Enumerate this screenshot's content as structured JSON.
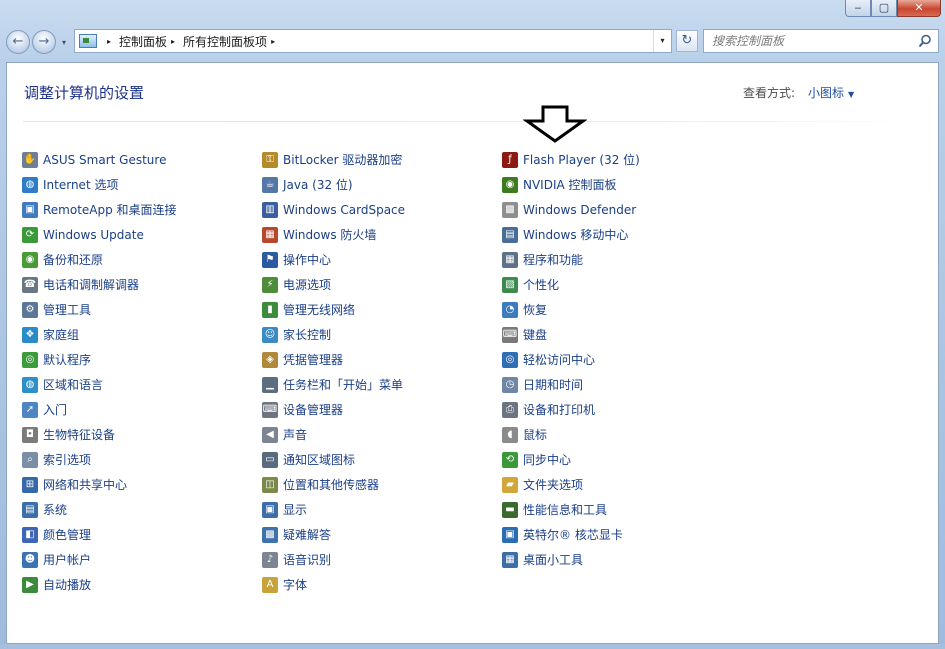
{
  "window": {
    "min_glyph": "‒",
    "max_glyph": "▢",
    "close_glyph": "✕"
  },
  "nav": {
    "back_glyph": "←",
    "forward_glyph": "→",
    "history_glyph": "▾",
    "breadcrumbs": [
      "控制面板",
      "所有控制面板项"
    ],
    "crumb_sep": "▸",
    "address_drop_glyph": "▾",
    "refresh_glyph": "↻",
    "search_placeholder": "搜索控制面板"
  },
  "header": {
    "title": "调整计算机的设置",
    "view_by_label": "查看方式:",
    "view_by_value": "小图标",
    "view_by_caret": "▼"
  },
  "colors": {
    "link": "#1a3f86",
    "title": "#1e3287"
  },
  "columns": [
    [
      {
        "label": "ASUS Smart Gesture",
        "icon": "touchpad-icon",
        "glyph": "✋",
        "color": "#6e7f93"
      },
      {
        "label": "Internet 选项",
        "icon": "globe-icon",
        "glyph": "◍",
        "color": "#2f7dc8"
      },
      {
        "label": "RemoteApp 和桌面连接",
        "icon": "remote-desktop-icon",
        "glyph": "▣",
        "color": "#3f7bbd"
      },
      {
        "label": "Windows Update",
        "icon": "windows-update-icon",
        "glyph": "⟳",
        "color": "#3a9a3a"
      },
      {
        "label": "备份和还原",
        "icon": "backup-icon",
        "glyph": "◉",
        "color": "#4a9a36"
      },
      {
        "label": "电话和调制解调器",
        "icon": "phone-modem-icon",
        "glyph": "☎",
        "color": "#6b7685"
      },
      {
        "label": "管理工具",
        "icon": "admin-tools-icon",
        "glyph": "⚙",
        "color": "#5d7896"
      },
      {
        "label": "家庭组",
        "icon": "homegroup-icon",
        "glyph": "❖",
        "color": "#2a8bc9"
      },
      {
        "label": "默认程序",
        "icon": "default-programs-icon",
        "glyph": "◎",
        "color": "#3c9c3c"
      },
      {
        "label": "区域和语言",
        "icon": "region-language-icon",
        "glyph": "◍",
        "color": "#2f8fc7"
      },
      {
        "label": "入门",
        "icon": "getting-started-icon",
        "glyph": "➚",
        "color": "#4d86c3"
      },
      {
        "label": "生物特征设备",
        "icon": "biometric-icon",
        "glyph": "◘",
        "color": "#7b7b7b"
      },
      {
        "label": "索引选项",
        "icon": "indexing-icon",
        "glyph": "⌕",
        "color": "#7a8ea8"
      },
      {
        "label": "网络和共享中心",
        "icon": "network-icon",
        "glyph": "⊞",
        "color": "#3569a8"
      },
      {
        "label": "系统",
        "icon": "system-icon",
        "glyph": "▤",
        "color": "#3c6fa9"
      },
      {
        "label": "颜色管理",
        "icon": "color-management-icon",
        "glyph": "◧",
        "color": "#3f66b6"
      },
      {
        "label": "用户帐户",
        "icon": "user-accounts-icon",
        "glyph": "☻",
        "color": "#3a74b5"
      },
      {
        "label": "自动播放",
        "icon": "autoplay-icon",
        "glyph": "▶",
        "color": "#3c8a3c"
      }
    ],
    [
      {
        "label": "BitLocker 驱动器加密",
        "icon": "bitlocker-icon",
        "glyph": "⚿",
        "color": "#b48a2a"
      },
      {
        "label": "Java (32 位)",
        "icon": "java-icon",
        "glyph": "☕",
        "color": "#5577a8"
      },
      {
        "label": "Windows CardSpace",
        "icon": "cardspace-icon",
        "glyph": "▥",
        "color": "#3b5f9e"
      },
      {
        "label": "Windows 防火墙",
        "icon": "firewall-icon",
        "glyph": "▦",
        "color": "#b7482e"
      },
      {
        "label": "操作中心",
        "icon": "action-center-icon",
        "glyph": "⚑",
        "color": "#2c5aa0"
      },
      {
        "label": "电源选项",
        "icon": "power-icon",
        "glyph": "⚡",
        "color": "#4f8c3a"
      },
      {
        "label": "管理无线网络",
        "icon": "wireless-icon",
        "glyph": "▮",
        "color": "#3d8b3d"
      },
      {
        "label": "家长控制",
        "icon": "parental-controls-icon",
        "glyph": "☺",
        "color": "#3c8bc4"
      },
      {
        "label": "凭据管理器",
        "icon": "credential-icon",
        "glyph": "◈",
        "color": "#b08a3a"
      },
      {
        "label": "任务栏和「开始」菜单",
        "icon": "taskbar-icon",
        "glyph": "▁",
        "color": "#5c6d82"
      },
      {
        "label": "设备管理器",
        "icon": "device-manager-icon",
        "glyph": "⌨",
        "color": "#6e7580"
      },
      {
        "label": "声音",
        "icon": "sound-icon",
        "glyph": "◀",
        "color": "#7c8591"
      },
      {
        "label": "通知区域图标",
        "icon": "notification-icon",
        "glyph": "▭",
        "color": "#5a6b80"
      },
      {
        "label": "位置和其他传感器",
        "icon": "sensors-icon",
        "glyph": "◫",
        "color": "#7b8a4a"
      },
      {
        "label": "显示",
        "icon": "display-icon",
        "glyph": "▣",
        "color": "#3c6fa9"
      },
      {
        "label": "疑难解答",
        "icon": "troubleshoot-icon",
        "glyph": "▩",
        "color": "#3f72ad"
      },
      {
        "label": "语音识别",
        "icon": "microphone-icon",
        "glyph": "♪",
        "color": "#7c8591"
      },
      {
        "label": "字体",
        "icon": "fonts-icon",
        "glyph": "A",
        "color": "#c8a33a"
      }
    ],
    [
      {
        "label": "Flash Player (32 位)",
        "icon": "flash-icon",
        "glyph": "ƒ",
        "color": "#8c1a12"
      },
      {
        "label": "NVIDIA 控制面板",
        "icon": "nvidia-icon",
        "glyph": "◉",
        "color": "#3e7a1f"
      },
      {
        "label": "Windows Defender",
        "icon": "defender-icon",
        "glyph": "▩",
        "color": "#8e8e8e"
      },
      {
        "label": "Windows 移动中心",
        "icon": "mobility-center-icon",
        "glyph": "▤",
        "color": "#4a6d98"
      },
      {
        "label": "程序和功能",
        "icon": "programs-features-icon",
        "glyph": "▦",
        "color": "#5f7089"
      },
      {
        "label": "个性化",
        "icon": "personalization-icon",
        "glyph": "▧",
        "color": "#3d8a4f"
      },
      {
        "label": "恢复",
        "icon": "recovery-icon",
        "glyph": "◔",
        "color": "#3b7cc0"
      },
      {
        "label": "键盘",
        "icon": "keyboard-icon",
        "glyph": "⌨",
        "color": "#7a7a7a"
      },
      {
        "label": "轻松访问中心",
        "icon": "ease-of-access-icon",
        "glyph": "◎",
        "color": "#2f6fb5"
      },
      {
        "label": "日期和时间",
        "icon": "clock-icon",
        "glyph": "◷",
        "color": "#6f86a4"
      },
      {
        "label": "设备和打印机",
        "icon": "printer-icon",
        "glyph": "⎙",
        "color": "#6b7480"
      },
      {
        "label": "鼠标",
        "icon": "mouse-icon",
        "glyph": "◖",
        "color": "#8a8a8a"
      },
      {
        "label": "同步中心",
        "icon": "sync-icon",
        "glyph": "⟲",
        "color": "#3a9a3a"
      },
      {
        "label": "文件夹选项",
        "icon": "folder-options-icon",
        "glyph": "▰",
        "color": "#d2a63a"
      },
      {
        "label": "性能信息和工具",
        "icon": "performance-icon",
        "glyph": "▬",
        "color": "#3b6a2e"
      },
      {
        "label": "英特尔® 核芯显卡",
        "icon": "intel-graphics-icon",
        "glyph": "▣",
        "color": "#2a6db3"
      },
      {
        "label": "桌面小工具",
        "icon": "gadgets-icon",
        "glyph": "▦",
        "color": "#3d6ea8"
      }
    ]
  ]
}
